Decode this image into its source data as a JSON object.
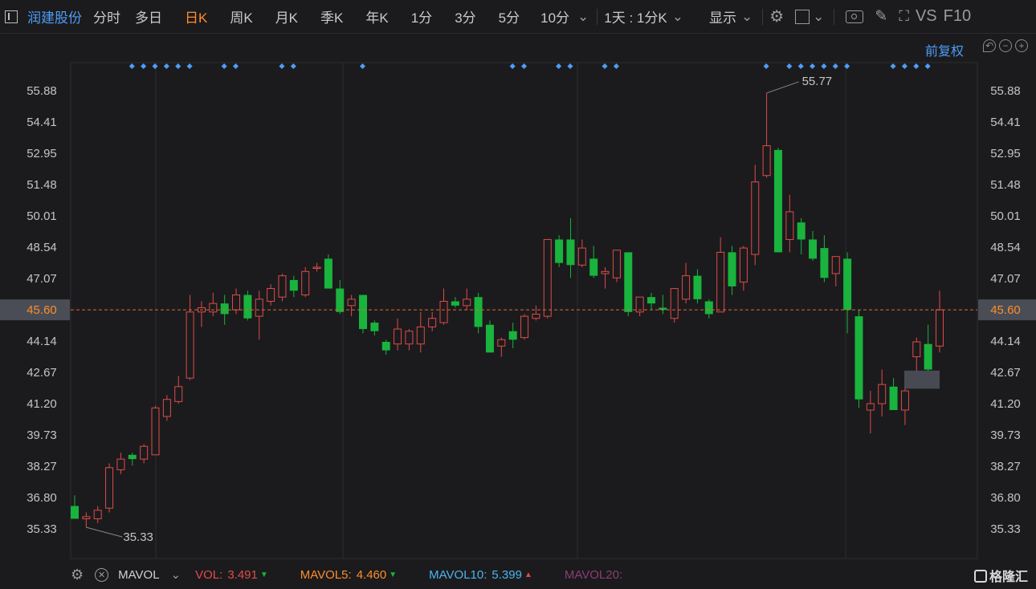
{
  "toolbar": {
    "stock_name": "润建股份",
    "periods": [
      "分时",
      "多日",
      "日K",
      "周K",
      "月K",
      "季K",
      "年K",
      "1分",
      "3分",
      "5分",
      "10分"
    ],
    "active_period": "日K",
    "minute_select": "1天 : 1分K",
    "display_label": "显示",
    "vs_label": "VS",
    "f10_label": "F10"
  },
  "adjust_label": "前复权",
  "colors": {
    "up": "#e04a4a",
    "down": "#19b33d",
    "accent": "#4d9df8",
    "active": "#ff8d2b",
    "price_line": "#e06a3a"
  },
  "bottom": {
    "indicator": "MAVOL",
    "vol_label": "VOL:",
    "vol_value": "3.491",
    "mavol5_label": "MAVOL5:",
    "mavol5_value": "4.460",
    "mavol10_label": "MAVOL10:",
    "mavol10_value": "5.399",
    "mavol20_label": "MAVOL20:",
    "brand": "格隆汇"
  },
  "chart_data": {
    "type": "candlestick",
    "y_ticks": [
      "55.88",
      "54.41",
      "52.95",
      "51.48",
      "50.01",
      "48.54",
      "47.07",
      "45.60",
      "44.14",
      "42.67",
      "41.20",
      "39.73",
      "38.27",
      "36.80",
      "35.33"
    ],
    "ylim": [
      34.5,
      57.1
    ],
    "current_price": "45.60",
    "high_label": "55.77",
    "low_label": "35.33",
    "candles": [
      {
        "o": 36.4,
        "h": 36.9,
        "l": 35.9,
        "c": 35.8
      },
      {
        "o": 35.8,
        "h": 36.1,
        "l": 35.4,
        "c": 35.9
      },
      {
        "o": 35.8,
        "h": 36.4,
        "l": 35.6,
        "c": 36.2
      },
      {
        "o": 36.3,
        "h": 38.4,
        "l": 36.1,
        "c": 38.2
      },
      {
        "o": 38.1,
        "h": 38.9,
        "l": 37.9,
        "c": 38.6
      },
      {
        "o": 38.8,
        "h": 38.9,
        "l": 38.3,
        "c": 38.6
      },
      {
        "o": 38.6,
        "h": 39.3,
        "l": 38.4,
        "c": 39.2
      },
      {
        "o": 38.8,
        "h": 41.1,
        "l": 38.8,
        "c": 41.0
      },
      {
        "o": 40.6,
        "h": 41.6,
        "l": 40.4,
        "c": 41.4
      },
      {
        "o": 41.3,
        "h": 42.5,
        "l": 41.2,
        "c": 42.0
      },
      {
        "o": 42.4,
        "h": 46.3,
        "l": 42.3,
        "c": 45.5
      },
      {
        "o": 45.5,
        "h": 46.0,
        "l": 44.8,
        "c": 45.7
      },
      {
        "o": 45.5,
        "h": 46.4,
        "l": 45.3,
        "c": 45.9
      },
      {
        "o": 45.9,
        "h": 46.3,
        "l": 44.9,
        "c": 45.4
      },
      {
        "o": 45.6,
        "h": 46.6,
        "l": 45.4,
        "c": 46.3
      },
      {
        "o": 46.3,
        "h": 46.5,
        "l": 45.1,
        "c": 45.2
      },
      {
        "o": 45.3,
        "h": 46.5,
        "l": 44.2,
        "c": 46.1
      },
      {
        "o": 46.0,
        "h": 46.8,
        "l": 45.8,
        "c": 46.6
      },
      {
        "o": 46.2,
        "h": 47.3,
        "l": 46.0,
        "c": 47.2
      },
      {
        "o": 47.0,
        "h": 47.2,
        "l": 46.2,
        "c": 46.5
      },
      {
        "o": 46.3,
        "h": 47.6,
        "l": 46.2,
        "c": 47.4
      },
      {
        "o": 47.6,
        "h": 47.8,
        "l": 47.4,
        "c": 47.6
      },
      {
        "o": 48.0,
        "h": 48.2,
        "l": 46.6,
        "c": 46.6
      },
      {
        "o": 46.6,
        "h": 47.0,
        "l": 45.4,
        "c": 45.5
      },
      {
        "o": 45.8,
        "h": 46.3,
        "l": 45.3,
        "c": 46.1
      },
      {
        "o": 46.3,
        "h": 46.3,
        "l": 44.5,
        "c": 44.7
      },
      {
        "o": 45.0,
        "h": 45.1,
        "l": 44.4,
        "c": 44.6
      },
      {
        "o": 44.1,
        "h": 44.2,
        "l": 43.5,
        "c": 43.7
      },
      {
        "o": 44.0,
        "h": 45.2,
        "l": 43.7,
        "c": 44.7
      },
      {
        "o": 44.0,
        "h": 44.7,
        "l": 43.7,
        "c": 44.6
      },
      {
        "o": 44.0,
        "h": 45.5,
        "l": 43.6,
        "c": 44.8
      },
      {
        "o": 44.8,
        "h": 45.5,
        "l": 44.6,
        "c": 45.2
      },
      {
        "o": 45.0,
        "h": 46.6,
        "l": 44.9,
        "c": 46.0
      },
      {
        "o": 46.0,
        "h": 46.2,
        "l": 45.7,
        "c": 45.8
      },
      {
        "o": 45.8,
        "h": 46.6,
        "l": 45.6,
        "c": 46.1
      },
      {
        "o": 46.2,
        "h": 46.4,
        "l": 44.5,
        "c": 44.8
      },
      {
        "o": 44.9,
        "h": 45.1,
        "l": 43.6,
        "c": 43.6
      },
      {
        "o": 43.9,
        "h": 44.3,
        "l": 43.4,
        "c": 44.2
      },
      {
        "o": 44.6,
        "h": 45.0,
        "l": 43.8,
        "c": 44.2
      },
      {
        "o": 44.3,
        "h": 45.4,
        "l": 44.2,
        "c": 45.3
      },
      {
        "o": 45.2,
        "h": 45.8,
        "l": 45.1,
        "c": 45.4
      },
      {
        "o": 45.3,
        "h": 48.9,
        "l": 45.2,
        "c": 48.9
      },
      {
        "o": 48.9,
        "h": 49.1,
        "l": 47.6,
        "c": 47.8
      },
      {
        "o": 48.9,
        "h": 49.9,
        "l": 47.1,
        "c": 47.7
      },
      {
        "o": 47.7,
        "h": 48.9,
        "l": 47.6,
        "c": 48.5
      },
      {
        "o": 48.0,
        "h": 48.6,
        "l": 47.1,
        "c": 47.2
      },
      {
        "o": 47.3,
        "h": 47.6,
        "l": 46.6,
        "c": 47.4
      },
      {
        "o": 47.1,
        "h": 48.4,
        "l": 46.9,
        "c": 48.4
      },
      {
        "o": 48.3,
        "h": 48.3,
        "l": 45.3,
        "c": 45.5
      },
      {
        "o": 45.5,
        "h": 46.2,
        "l": 45.3,
        "c": 46.2
      },
      {
        "o": 46.2,
        "h": 46.4,
        "l": 45.6,
        "c": 45.9
      },
      {
        "o": 45.7,
        "h": 46.3,
        "l": 45.4,
        "c": 45.6
      },
      {
        "o": 45.2,
        "h": 46.6,
        "l": 45.0,
        "c": 46.6
      },
      {
        "o": 46.1,
        "h": 47.8,
        "l": 45.9,
        "c": 47.2
      },
      {
        "o": 47.2,
        "h": 47.5,
        "l": 45.9,
        "c": 46.1
      },
      {
        "o": 46.0,
        "h": 46.1,
        "l": 45.2,
        "c": 45.4
      },
      {
        "o": 45.5,
        "h": 49.0,
        "l": 45.5,
        "c": 48.3
      },
      {
        "o": 48.3,
        "h": 48.6,
        "l": 46.3,
        "c": 46.7
      },
      {
        "o": 46.9,
        "h": 48.6,
        "l": 46.5,
        "c": 48.5
      },
      {
        "o": 48.2,
        "h": 52.4,
        "l": 47.7,
        "c": 51.6
      },
      {
        "o": 51.9,
        "h": 55.77,
        "l": 51.8,
        "c": 53.3
      },
      {
        "o": 53.1,
        "h": 53.2,
        "l": 48.3,
        "c": 48.3
      },
      {
        "o": 48.9,
        "h": 51.0,
        "l": 48.3,
        "c": 50.2
      },
      {
        "o": 49.7,
        "h": 49.9,
        "l": 48.2,
        "c": 48.9
      },
      {
        "o": 48.9,
        "h": 49.3,
        "l": 47.9,
        "c": 48.0
      },
      {
        "o": 48.5,
        "h": 49.1,
        "l": 46.9,
        "c": 47.1
      },
      {
        "o": 47.3,
        "h": 48.0,
        "l": 46.7,
        "c": 48.1
      },
      {
        "o": 48.0,
        "h": 48.3,
        "l": 44.5,
        "c": 45.6
      },
      {
        "o": 45.3,
        "h": 45.6,
        "l": 41.0,
        "c": 41.4
      },
      {
        "o": 40.9,
        "h": 41.8,
        "l": 39.8,
        "c": 41.2
      },
      {
        "o": 41.2,
        "h": 42.8,
        "l": 40.6,
        "c": 42.1
      },
      {
        "o": 42.0,
        "h": 42.4,
        "l": 40.9,
        "c": 40.9
      },
      {
        "o": 40.9,
        "h": 42.0,
        "l": 40.2,
        "c": 41.8
      },
      {
        "o": 43.4,
        "h": 44.3,
        "l": 42.7,
        "c": 44.1
      },
      {
        "o": 44.0,
        "h": 44.9,
        "l": 42.7,
        "c": 42.8
      },
      {
        "o": 43.9,
        "h": 46.5,
        "l": 43.6,
        "c": 45.6
      }
    ]
  }
}
